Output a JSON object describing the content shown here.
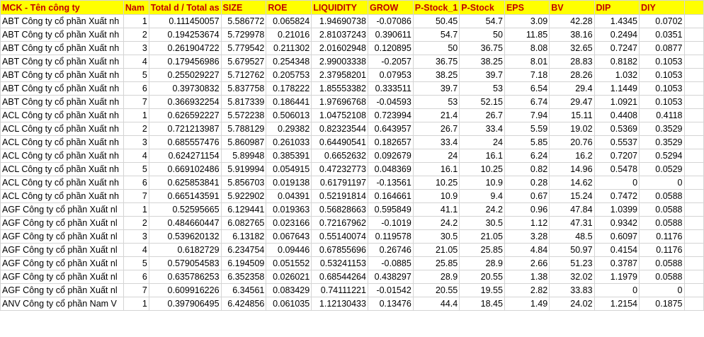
{
  "sheet": {
    "headers": [
      "MCK - Tên công ty",
      "Nam",
      "Total d / Total as",
      "SIZE",
      "ROE",
      "LIQUIDITY",
      "GROW",
      "P-Stock_1",
      "P-Stock",
      "EPS",
      "BV",
      "DIP",
      "DIY",
      ""
    ],
    "rows": [
      [
        "ABT Công ty cổ phần Xuất nh",
        "1",
        "0.111450057",
        "5.586772",
        "0.065824",
        "1.94690738",
        "-0.07086",
        "50.45",
        "54.7",
        "3.09",
        "42.28",
        "1.4345",
        "0.0702",
        ""
      ],
      [
        "ABT Công ty cổ phần Xuất nh",
        "2",
        "0.194253674",
        "5.729978",
        "0.21016",
        "2.81037243",
        "0.390611",
        "54.7",
        "50",
        "11.85",
        "38.16",
        "0.2494",
        "0.0351",
        ""
      ],
      [
        "ABT Công ty cổ phần Xuất nh",
        "3",
        "0.261904722",
        "5.779542",
        "0.211302",
        "2.01602948",
        "0.120895",
        "50",
        "36.75",
        "8.08",
        "32.65",
        "0.7247",
        "0.0877",
        ""
      ],
      [
        "ABT Công ty cổ phần Xuất nh",
        "4",
        "0.179456986",
        "5.679527",
        "0.254348",
        "2.99003338",
        "-0.2057",
        "36.75",
        "38.25",
        "8.01",
        "28.83",
        "0.8182",
        "0.1053",
        ""
      ],
      [
        "ABT Công ty cổ phần Xuất nh",
        "5",
        "0.255029227",
        "5.712762",
        "0.205753",
        "2.37958201",
        "0.07953",
        "38.25",
        "39.7",
        "7.18",
        "28.26",
        "1.032",
        "0.1053",
        ""
      ],
      [
        "ABT Công ty cổ phần Xuất nh",
        "6",
        "0.39730832",
        "5.837758",
        "0.178222",
        "1.85553382",
        "0.333511",
        "39.7",
        "53",
        "6.54",
        "29.4",
        "1.1449",
        "0.1053",
        ""
      ],
      [
        "ABT Công ty cổ phần Xuất nh",
        "7",
        "0.366932254",
        "5.817339",
        "0.186441",
        "1.97696768",
        "-0.04593",
        "53",
        "52.15",
        "6.74",
        "29.47",
        "1.0921",
        "0.1053",
        ""
      ],
      [
        "ACL Công ty cổ phần Xuất nh",
        "1",
        "0.626592227",
        "5.572238",
        "0.506013",
        "1.04752108",
        "0.723994",
        "21.4",
        "26.7",
        "7.94",
        "15.11",
        "0.4408",
        "0.4118",
        ""
      ],
      [
        "ACL Công ty cổ phần Xuất nh",
        "2",
        "0.721213987",
        "5.788129",
        "0.29382",
        "0.82323544",
        "0.643957",
        "26.7",
        "33.4",
        "5.59",
        "19.02",
        "0.5369",
        "0.3529",
        ""
      ],
      [
        "ACL Công ty cổ phần Xuất nh",
        "3",
        "0.685557476",
        "5.860987",
        "0.261033",
        "0.64490541",
        "0.182657",
        "33.4",
        "24",
        "5.85",
        "20.76",
        "0.5537",
        "0.3529",
        ""
      ],
      [
        "ACL Công ty cổ phần Xuất nh",
        "4",
        "0.624271154",
        "5.89948",
        "0.385391",
        "0.6652632",
        "0.092679",
        "24",
        "16.1",
        "6.24",
        "16.2",
        "0.7207",
        "0.5294",
        ""
      ],
      [
        "ACL Công ty cổ phần Xuất nh",
        "5",
        "0.669102486",
        "5.919994",
        "0.054915",
        "0.47232773",
        "0.048369",
        "16.1",
        "10.25",
        "0.82",
        "14.96",
        "0.5478",
        "0.0529",
        ""
      ],
      [
        "ACL Công ty cổ phần Xuất nh",
        "6",
        "0.625853841",
        "5.856703",
        "0.019138",
        "0.61791197",
        "-0.13561",
        "10.25",
        "10.9",
        "0.28",
        "14.62",
        "0",
        "0",
        ""
      ],
      [
        "ACL Công ty cổ phần Xuất nh",
        "7",
        "0.665143591",
        "5.922902",
        "0.04391",
        "0.52191814",
        "0.164661",
        "10.9",
        "9.4",
        "0.67",
        "15.24",
        "0.7472",
        "0.0588",
        ""
      ],
      [
        "AGF Công ty cổ phần Xuất nl",
        "1",
        "0.52595665",
        "6.129441",
        "0.019363",
        "0.56828663",
        "0.595849",
        "41.1",
        "24.2",
        "0.96",
        "47.84",
        "1.0399",
        "0.0588",
        ""
      ],
      [
        "AGF Công ty cổ phần Xuất nl",
        "2",
        "0.484660447",
        "6.082765",
        "0.023166",
        "0.72167962",
        "-0.1019",
        "24.2",
        "30.5",
        "1.12",
        "47.31",
        "0.9342",
        "0.0588",
        ""
      ],
      [
        "AGF Công ty cổ phần Xuất nl",
        "3",
        "0.539620132",
        "6.13182",
        "0.067643",
        "0.55140074",
        "0.119578",
        "30.5",
        "21.05",
        "3.28",
        "48.5",
        "0.6097",
        "0.1176",
        ""
      ],
      [
        "AGF Công ty cổ phần Xuất nl",
        "4",
        "0.6182729",
        "6.234754",
        "0.09446",
        "0.67855696",
        "0.26746",
        "21.05",
        "25.85",
        "4.84",
        "50.97",
        "0.4154",
        "0.1176",
        ""
      ],
      [
        "AGF Công ty cổ phần Xuất nl",
        "5",
        "0.579054583",
        "6.194509",
        "0.051552",
        "0.53241153",
        "-0.0885",
        "25.85",
        "28.9",
        "2.66",
        "51.23",
        "0.3787",
        "0.0588",
        ""
      ],
      [
        "AGF Công ty cổ phần Xuất nl",
        "6",
        "0.635786253",
        "6.352358",
        "0.026021",
        "0.68544264",
        "0.438297",
        "28.9",
        "20.55",
        "1.38",
        "32.02",
        "1.1979",
        "0.0588",
        ""
      ],
      [
        "AGF Công ty cổ phần Xuất nl",
        "7",
        "0.609916226",
        "6.34561",
        "0.083429",
        "0.74111221",
        "-0.01542",
        "20.55",
        "19.55",
        "2.82",
        "33.83",
        "0",
        "0",
        ""
      ],
      [
        "ANV Công ty cổ phần Nam V",
        "1",
        "0.397906495",
        "6.424856",
        "0.061035",
        "1.12130433",
        "0.13476",
        "44.4",
        "18.45",
        "1.49",
        "24.02",
        "1.2154",
        "0.1875",
        ""
      ]
    ]
  }
}
